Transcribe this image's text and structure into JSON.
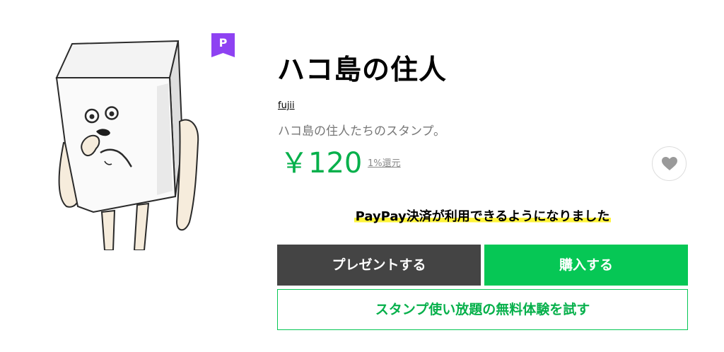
{
  "badge": {
    "letter": "P",
    "color": "#8e42f2"
  },
  "product": {
    "title": "ハコ島の住人",
    "author": "fujii",
    "description": "ハコ島の住人たちのスタンプ。",
    "price": "￥120",
    "rebate": "1%還元"
  },
  "favorite": {
    "icon": "heart-icon"
  },
  "paypay_notice": "PayPay決済が利用できるようになりました",
  "buttons": {
    "present": "プレゼントする",
    "buy": "購入する",
    "trial": "スタンプ使い放題の無料体験を試す"
  },
  "colors": {
    "accent_green": "#06c755",
    "price_green": "#06b04b",
    "dark_button": "#444444",
    "highlight_yellow": "#fff43b"
  }
}
